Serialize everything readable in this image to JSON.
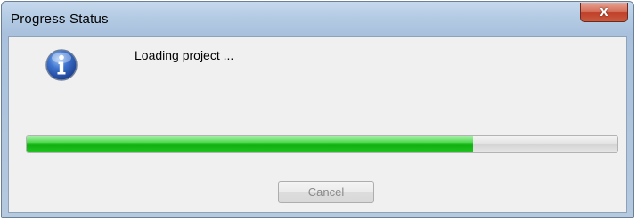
{
  "window": {
    "title": "Progress Status",
    "close_label": "x"
  },
  "dialog": {
    "icon": "information-icon",
    "message": "Loading project ...",
    "progress_fraction": 0.755,
    "cancel_label": "Cancel",
    "cancel_enabled": false
  },
  "colors": {
    "progress_fill": "#22c422",
    "close_button": "#c0402a",
    "info_icon": "#2f5fb8"
  }
}
